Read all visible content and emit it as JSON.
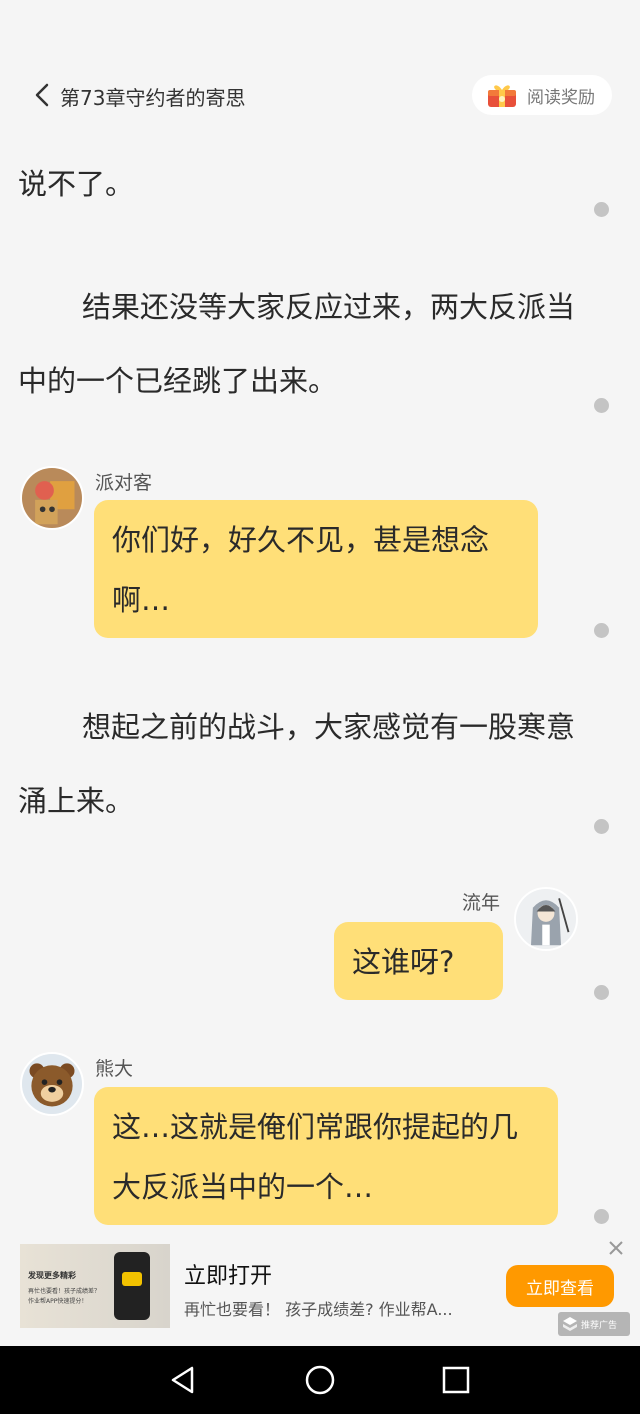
{
  "header": {
    "chapter_title": "第73章守约者的寄思",
    "reward_label": "阅读奖励"
  },
  "content": {
    "para1": "说不了。",
    "para2": "结果还没等大家反应过来，两大反派当中的一个已经跳了出来。",
    "msg1": {
      "name": "派对客",
      "text": "你们好，好久不见，甚是想念啊…"
    },
    "para3": "想起之前的战斗，大家感觉有一股寒意涌上来。",
    "msg2": {
      "name": "流年",
      "text": "这谁呀?"
    },
    "msg3": {
      "name": "熊大",
      "text": "这…这就是俺们常跟你提起的几大反派当中的一个…"
    }
  },
  "ad": {
    "image_title": "发现更多精彩",
    "image_line1": "再忙也要看！孩子成绩差？",
    "image_line2": "作业帮APP快速提分！",
    "title": "立即打开",
    "description": "再忙也要看！ 孩子成绩差? 作业帮A...",
    "cta_label": "立即查看",
    "tag_label": "推荐广告"
  },
  "colors": {
    "background": "#f5f5f5",
    "bubble": "#ffdf78",
    "cta": "#ff9900",
    "navbar": "#000000"
  },
  "icons": [
    "chevron-left-icon",
    "gift-icon",
    "close-icon",
    "ad-logo-icon",
    "nav-back-icon",
    "nav-home-icon",
    "nav-recents-icon"
  ]
}
